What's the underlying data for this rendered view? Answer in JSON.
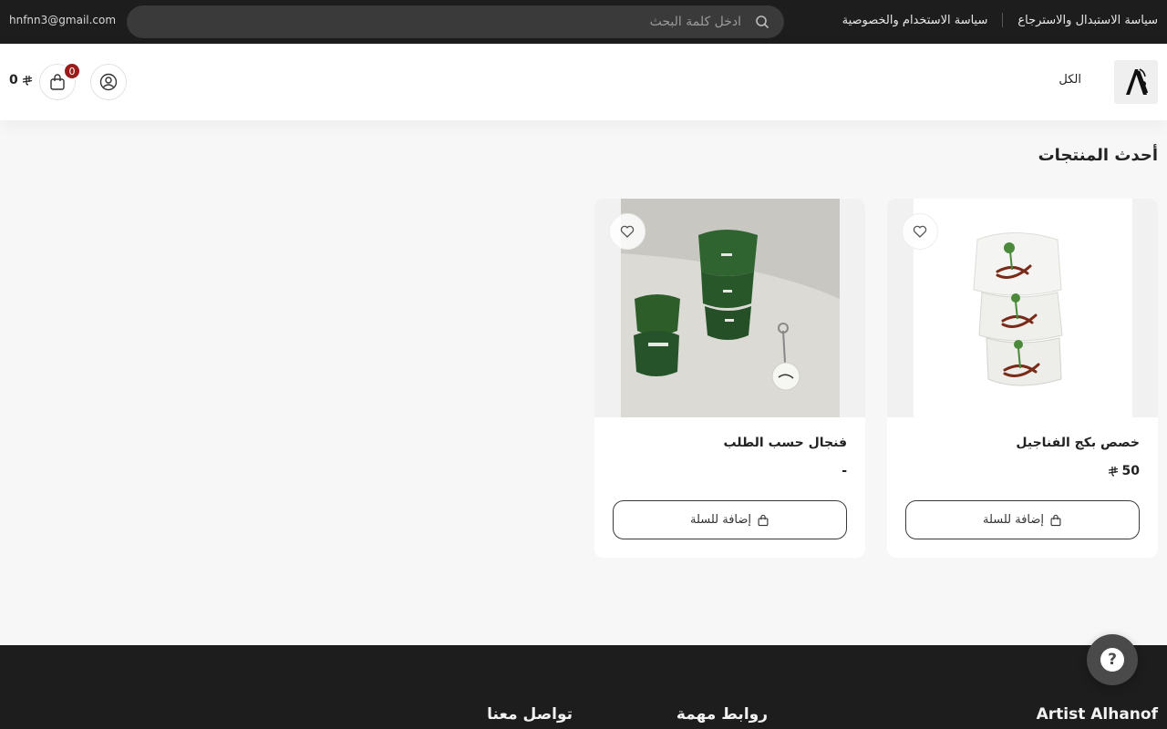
{
  "topbar": {
    "links": [
      "سياسة الاستبدال والاسترجاع",
      "سياسة الاستخدام والخصوصية"
    ],
    "search_placeholder": "ادخل كلمة البحث",
    "email": "hnfnn3@gmail.com"
  },
  "header": {
    "nav_all": "الكل",
    "cart_count": "0",
    "cart_total": "0",
    "currency_icon": "riyal-symbol-icon"
  },
  "section": {
    "title": "أحدث المنتجات"
  },
  "products": [
    {
      "name": "خصص بكج الفناجيل",
      "price": "50",
      "add_label": "إضافة للسلة",
      "image": "white-cups-stack"
    },
    {
      "name": "فنجال حسب الطلب",
      "price": "-",
      "add_label": "إضافة للسلة",
      "image": "green-cups-keychain"
    }
  ],
  "footer": {
    "brand": "Artist Alhanof",
    "links_title": "روابط مهمة",
    "contact_title": "تواصل معنا"
  },
  "colors": {
    "dark": "#1d1d1d",
    "badge": "#9b1b1b",
    "page_bg": "#f7f7f8"
  }
}
